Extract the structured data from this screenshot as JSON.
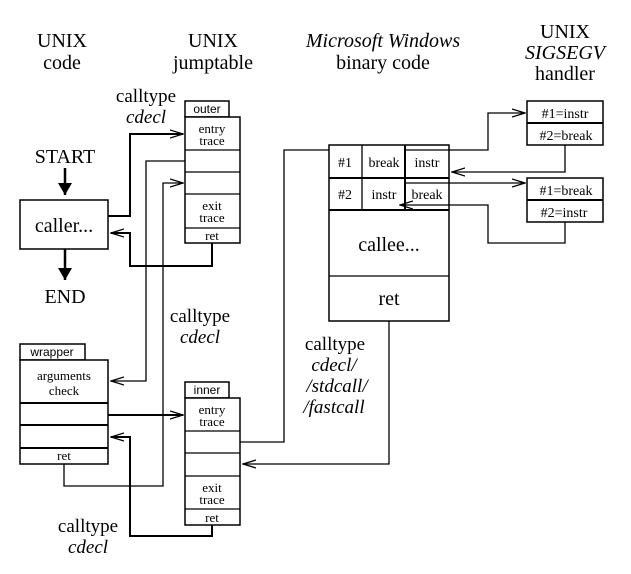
{
  "headers": {
    "unix_code": [
      "UNIX",
      "code"
    ],
    "unix_jumptable": [
      "UNIX",
      "jumptable"
    ],
    "windows_binary": [
      "Microsoft Windows",
      "binary code"
    ],
    "sigsegv_handler": [
      "UNIX",
      "SIGSEGV",
      "handler"
    ]
  },
  "flow": {
    "start": "START",
    "end": "END",
    "caller": "caller...",
    "callee": "callee...",
    "callee_ret": "ret"
  },
  "calltypes": {
    "outer_in": [
      "calltype",
      "cdecl"
    ],
    "wrapper_in": [
      "calltype",
      "cdecl"
    ],
    "inner_out": [
      "calltype",
      "cdecl/",
      "/stdcall/",
      "/fastcall"
    ],
    "inner_ret": [
      "calltype",
      "cdecl"
    ]
  },
  "outer": {
    "tab": "outer",
    "entry": [
      "entry",
      "trace"
    ],
    "exit": [
      "exit",
      "trace"
    ],
    "ret": "ret"
  },
  "inner": {
    "tab": "inner",
    "entry": [
      "entry",
      "trace"
    ],
    "exit": [
      "exit",
      "trace"
    ],
    "ret": "ret"
  },
  "wrapper": {
    "tab": "wrapper",
    "check": [
      "arguments",
      "check"
    ],
    "ret": "ret"
  },
  "breakpoint_table": {
    "rows": [
      {
        "id": "#1",
        "a": "break",
        "b": "instr"
      },
      {
        "id": "#2",
        "a": "instr",
        "b": "break"
      }
    ]
  },
  "handlers": [
    {
      "row1": "#1=instr",
      "row2": "#2=break"
    },
    {
      "row1": "#1=break",
      "row2": "#2=instr"
    }
  ]
}
